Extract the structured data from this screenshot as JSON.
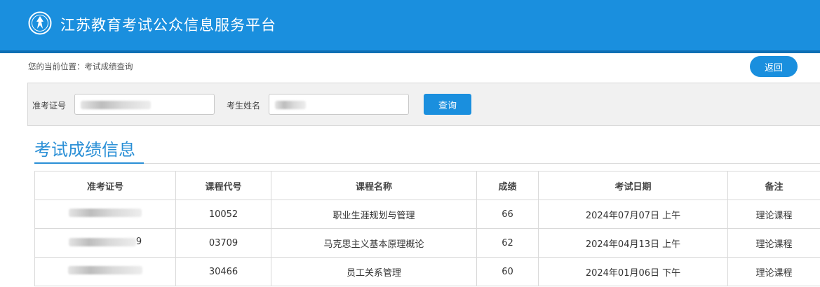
{
  "header": {
    "title": "江苏教育考试公众信息服务平台",
    "logo_icon": "exam-authority-emblem"
  },
  "breadcrumb": {
    "text": "您的当前位置：考试成绩查询"
  },
  "back_button": {
    "label": "返回"
  },
  "search": {
    "ticket_label": "准考证号",
    "name_label": "考生姓名",
    "query_label": "查询"
  },
  "section": {
    "title": "考试成绩信息"
  },
  "table": {
    "headers": [
      "准考证号",
      "课程代号",
      "课程名称",
      "成绩",
      "考试日期",
      "备注"
    ],
    "rows": [
      {
        "ticket_tail": "",
        "course_code": "10052",
        "course_name": "职业生涯规划与管理",
        "score": "66",
        "date": "2024年07月07日 上午",
        "note": "理论课程"
      },
      {
        "ticket_tail": "9",
        "course_code": "03709",
        "course_name": "马克思主义基本原理概论",
        "score": "62",
        "date": "2024年04月13日 上午",
        "note": "理论课程"
      },
      {
        "ticket_tail": "",
        "course_code": "30466",
        "course_name": "员工关系管理",
        "score": "60",
        "date": "2024年01月06日 下午",
        "note": "理论课程"
      }
    ]
  },
  "colors": {
    "primary": "#1a8fde",
    "header_border": "#0f6fb4",
    "title_blue": "#2a8fd6"
  }
}
